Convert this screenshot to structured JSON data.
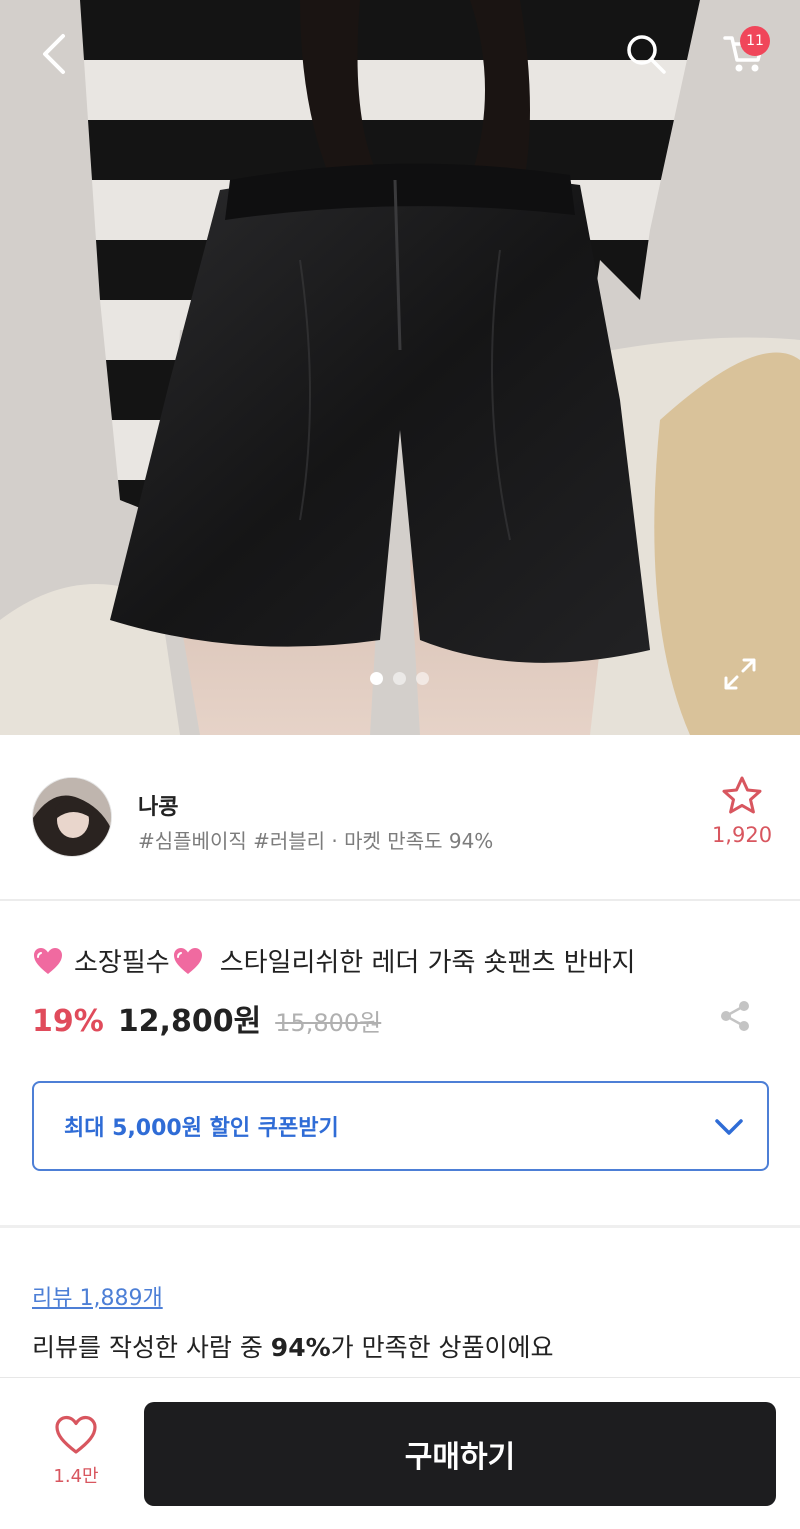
{
  "header": {
    "back_icon": "chevron-left-icon",
    "search_icon": "search-icon",
    "cart_icon": "cart-icon",
    "cart_count": "11"
  },
  "gallery": {
    "total_images": 3,
    "active_index": 0,
    "expand_icon": "expand-icon"
  },
  "shop": {
    "name": "나콩",
    "tags": "#심플베이직 #러블리 · 마켓 만족도 94%",
    "favorite_icon": "star-outline-icon",
    "favorite_count": "1,920"
  },
  "product": {
    "title_prefix": "소장필수",
    "title": "스타일리쉬한 레더 가죽 숏팬츠 반바지",
    "discount": "19%",
    "price": "12,800원",
    "original_price": "15,800원",
    "share_icon": "share-icon"
  },
  "coupon": {
    "label": "최대 5,000원 할인 쿠폰받기",
    "chevron_icon": "chevron-down-icon"
  },
  "review": {
    "link": "리뷰 1,889개",
    "text_before": "리뷰를 작성한 사람 중 ",
    "percent": "94%",
    "text_after": "가 만족한 상품이에요"
  },
  "bottom_bar": {
    "like_icon": "heart-outline-icon",
    "like_count": "1.4만",
    "buy_label": "구매하기"
  },
  "colors": {
    "accent_red": "#e04b5b",
    "accent_blue": "#2f6cd6",
    "buy_button": "#1d1d1f",
    "badge": "#f0465a"
  }
}
